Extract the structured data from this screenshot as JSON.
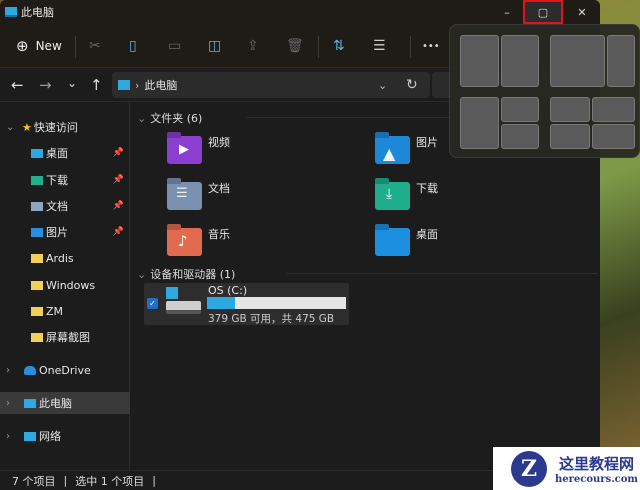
{
  "window": {
    "title": "此电脑",
    "min": "–",
    "max": "▢",
    "close": "✕"
  },
  "toolbar": {
    "new_label": "New",
    "more": "•••"
  },
  "nav": {
    "back": "←",
    "forward": "→",
    "recent": "⌄",
    "up": "↑",
    "address": "此电脑",
    "sep": "›",
    "dropdown": "⌄",
    "refresh": "↻"
  },
  "sidebar": {
    "quick_access": "快速访问",
    "items": [
      {
        "label": "桌面",
        "pinned": true
      },
      {
        "label": "下载",
        "pinned": true
      },
      {
        "label": "文档",
        "pinned": true
      },
      {
        "label": "图片",
        "pinned": true
      },
      {
        "label": "Ardis"
      },
      {
        "label": "Windows"
      },
      {
        "label": "ZM"
      },
      {
        "label": "屏幕截图"
      }
    ],
    "onedrive": "OneDrive",
    "this_pc": "此电脑",
    "network": "网络"
  },
  "content": {
    "folders_header": "文件夹 (6)",
    "folders": [
      "视频",
      "图片",
      "文档",
      "下载",
      "音乐",
      "桌面"
    ],
    "devices_header": "设备和驱动器 (1)",
    "drive": {
      "name": "OS (C:)",
      "info": "379 GB 可用，共 475 GB",
      "used_fraction": 0.2,
      "selected": true
    }
  },
  "status": {
    "items": "7 个项目",
    "selected": "选中 1 个项目",
    "divider": "|"
  },
  "watermark": {
    "title": "这里教程网",
    "url": "herecours.com"
  },
  "colors": {
    "accent": "#2ea8e0",
    "highlight": "#e0141a"
  }
}
